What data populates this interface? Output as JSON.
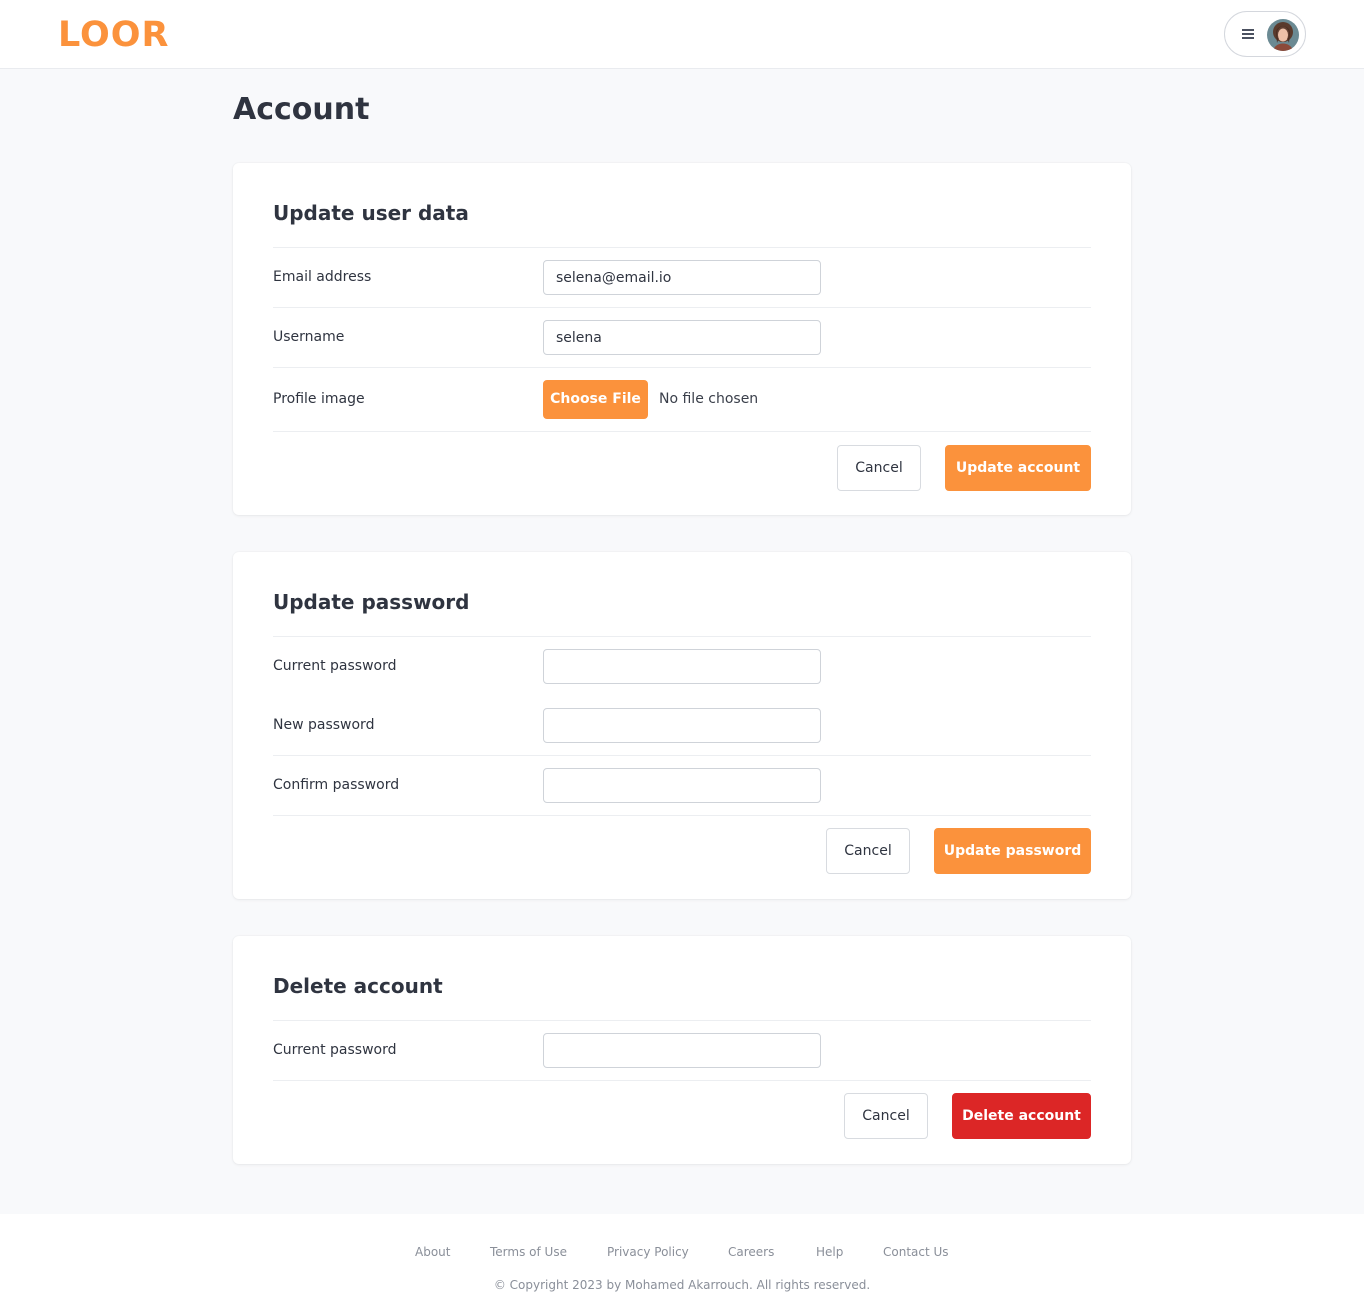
{
  "brand": {
    "logo_text": "LOOR",
    "accent_color": "#fb923c",
    "danger_color": "#dc2626"
  },
  "header": {
    "menu_icon": "hamburger-icon",
    "avatar_alt": "user-avatar"
  },
  "page": {
    "title": "Account"
  },
  "user_data": {
    "title": "Update user data",
    "email_label": "Email address",
    "email_value": "selena@email.io",
    "username_label": "Username",
    "username_value": "selena",
    "profile_image_label": "Profile image",
    "choose_file_label": "Choose File",
    "file_status": "No file chosen",
    "cancel_label": "Cancel",
    "submit_label": "Update account"
  },
  "password": {
    "title": "Update password",
    "current_label": "Current password",
    "new_label": "New password",
    "confirm_label": "Confirm password",
    "cancel_label": "Cancel",
    "submit_label": "Update password"
  },
  "delete": {
    "title": "Delete account",
    "current_label": "Current password",
    "cancel_label": "Cancel",
    "submit_label": "Delete account"
  },
  "footer": {
    "links": [
      "About",
      "Terms of Use",
      "Privacy Policy",
      "Careers",
      "Help",
      "Contact Us"
    ],
    "copyright": "© Copyright 2023 by Mohamed Akarrouch. All rights reserved."
  }
}
